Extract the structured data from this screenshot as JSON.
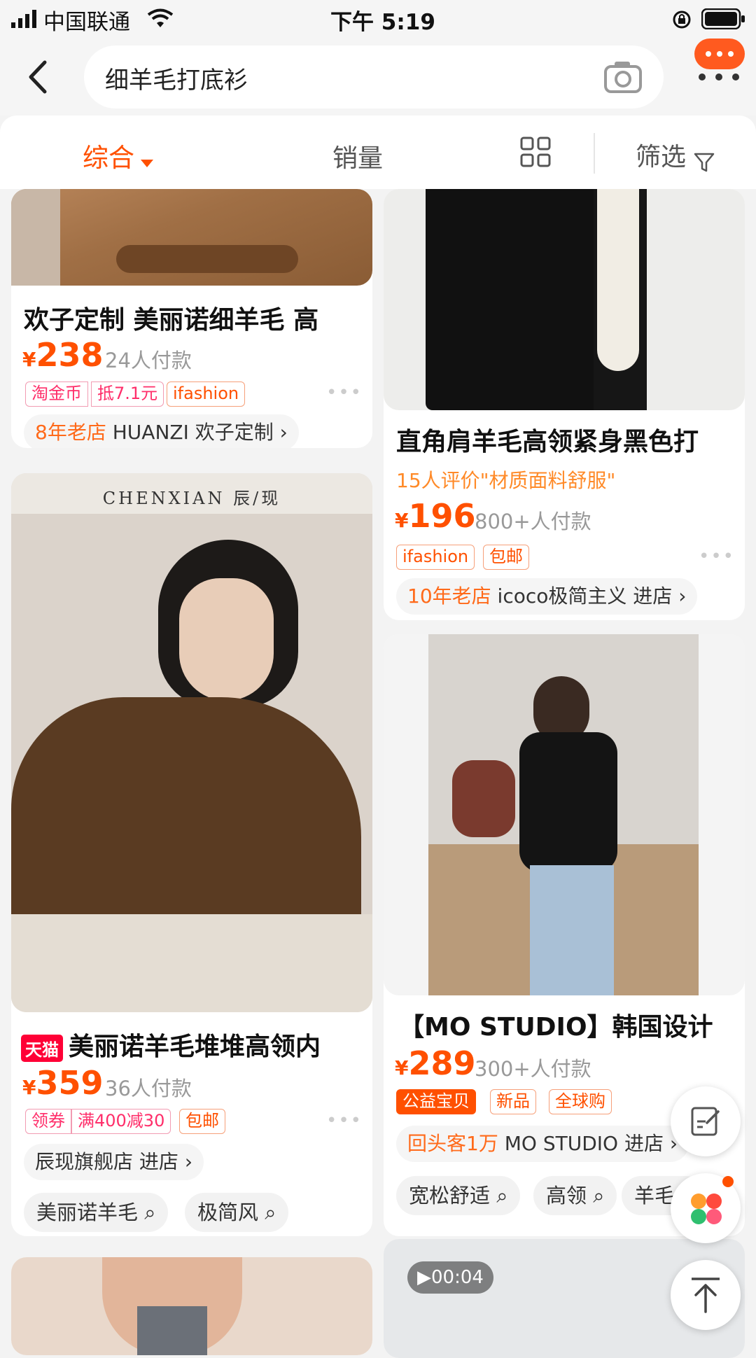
{
  "status_bar": {
    "carrier": "中国联通",
    "time": "下午 5:19"
  },
  "search": {
    "query": "细羊毛打底衫"
  },
  "filters": {
    "comprehensive": "综合",
    "sales": "销量",
    "filter": "筛选"
  },
  "colors": {
    "accent": "#ff5000",
    "tmall": "#ff0036",
    "highlight": "#ff8a28"
  },
  "products": [
    {
      "title": "欢子定制 美丽诺细羊毛 高",
      "currency": "¥",
      "price": "238",
      "sales": "24人付款",
      "tags": [
        "淘金币",
        "抵7.1元",
        "ifashion"
      ],
      "shop_age": "8年老店",
      "shop_name": "HUANZI 欢子定制",
      "more": "•••"
    },
    {
      "title": "直角肩羊毛高领紧身黑色打",
      "review_highlight": "15人评价\"材质面料舒服\"",
      "currency": "¥",
      "price": "196",
      "sales": "800+人付款",
      "tags": [
        "ifashion",
        "包邮"
      ],
      "shop_age": "10年老店",
      "shop_name": "icoco极简主义",
      "enter_shop": "进店",
      "more": "•••"
    },
    {
      "brand_header": "CHENXIAN 辰/现",
      "badge": "天猫",
      "title": "美丽诺羊毛堆堆高领内",
      "currency": "¥",
      "price": "359",
      "sales": "36人付款",
      "tags": [
        "领券",
        "满400减30",
        "包邮"
      ],
      "shop_name": "辰现旗舰店",
      "enter_shop": "进店",
      "keywords": [
        "美丽诺羊毛",
        "极简风"
      ],
      "more": "•••"
    },
    {
      "title": "【MO STUDIO】韩国设计",
      "currency": "¥",
      "price": "289",
      "sales": "300+人付款",
      "tags": [
        "公益宝贝",
        "新品",
        "全球购"
      ],
      "shop_age": "回头客1万",
      "shop_name": "MO STUDIO",
      "enter_shop": "进店",
      "keywords": [
        "宽松舒适",
        "高领",
        "羊毛"
      ]
    }
  ],
  "video": {
    "duration": "00:04"
  }
}
